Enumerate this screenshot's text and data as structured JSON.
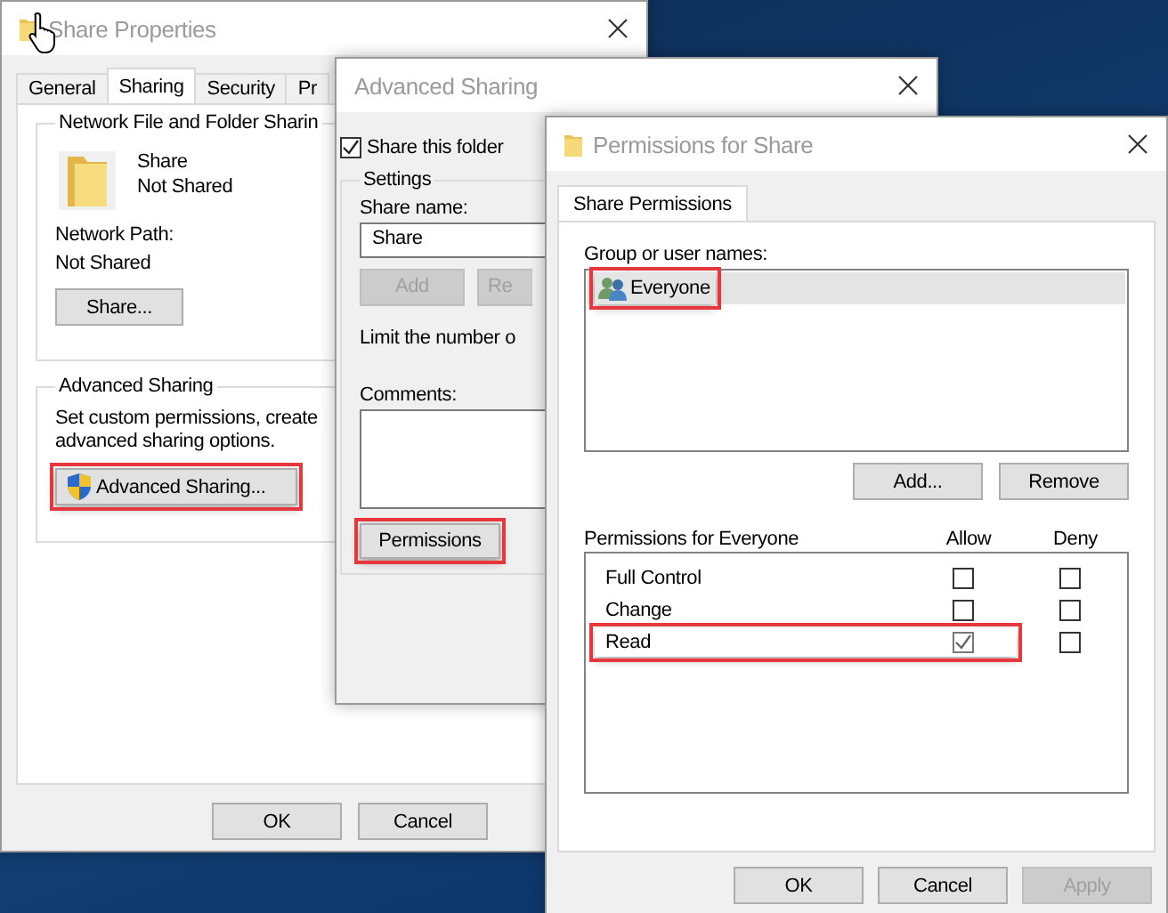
{
  "share_properties": {
    "title": "Share Properties",
    "tabs": [
      {
        "label": "General",
        "selected": false
      },
      {
        "label": "Sharing",
        "selected": true
      },
      {
        "label": "Security",
        "selected": false
      },
      {
        "label": "Pr",
        "selected": false
      }
    ],
    "network_sharing": {
      "heading": "Network File and Folder Sharin",
      "name": "Share",
      "status": "Not Shared",
      "path_label": "Network Path:",
      "path_value": "Not Shared",
      "button": "Share..."
    },
    "advanced_sharing": {
      "heading": "Advanced Sharing",
      "description": [
        "Set custom permissions, create",
        "advanced sharing options."
      ],
      "button": {
        "label": "Advanced Sharing...",
        "highlighted": true
      }
    },
    "buttons": [
      "OK",
      "Cancel"
    ]
  },
  "advanced_sharing_dialog": {
    "title": "Advanced Sharing",
    "share_this_folder": {
      "label": "Share this folder",
      "checked": true
    },
    "settings": {
      "heading": "Settings",
      "share_name_label": "Share name:",
      "share_name": "Share",
      "buttons": [
        {
          "label": "Add",
          "disabled": true
        },
        {
          "label": "Re",
          "disabled": true
        }
      ],
      "limit_text": "Limit the number o",
      "comments_label": "Comments:",
      "permissions_button": {
        "label": "Permissions",
        "highlighted": true
      }
    }
  },
  "permissions_dialog": {
    "title": "Permissions for Share",
    "tabs": [
      {
        "label": "Share Permissions",
        "selected": true
      }
    ],
    "group_label": "Group or user names:",
    "users": [
      {
        "name": "Everyone",
        "selected": true,
        "highlighted": true
      }
    ],
    "user_buttons": [
      "Add...",
      "Remove"
    ],
    "permissions_heading": "Permissions for Everyone",
    "columns": [
      "Allow",
      "Deny"
    ],
    "permissions": [
      {
        "name": "Full Control",
        "allow": false,
        "deny": false,
        "highlighted": false
      },
      {
        "name": "Change",
        "allow": false,
        "deny": false,
        "highlighted": false
      },
      {
        "name": "Read",
        "allow": true,
        "deny": false,
        "highlighted": true
      }
    ],
    "buttons": [
      {
        "label": "OK",
        "disabled": false
      },
      {
        "label": "Cancel",
        "disabled": false
      },
      {
        "label": "Apply",
        "disabled": true
      }
    ]
  }
}
